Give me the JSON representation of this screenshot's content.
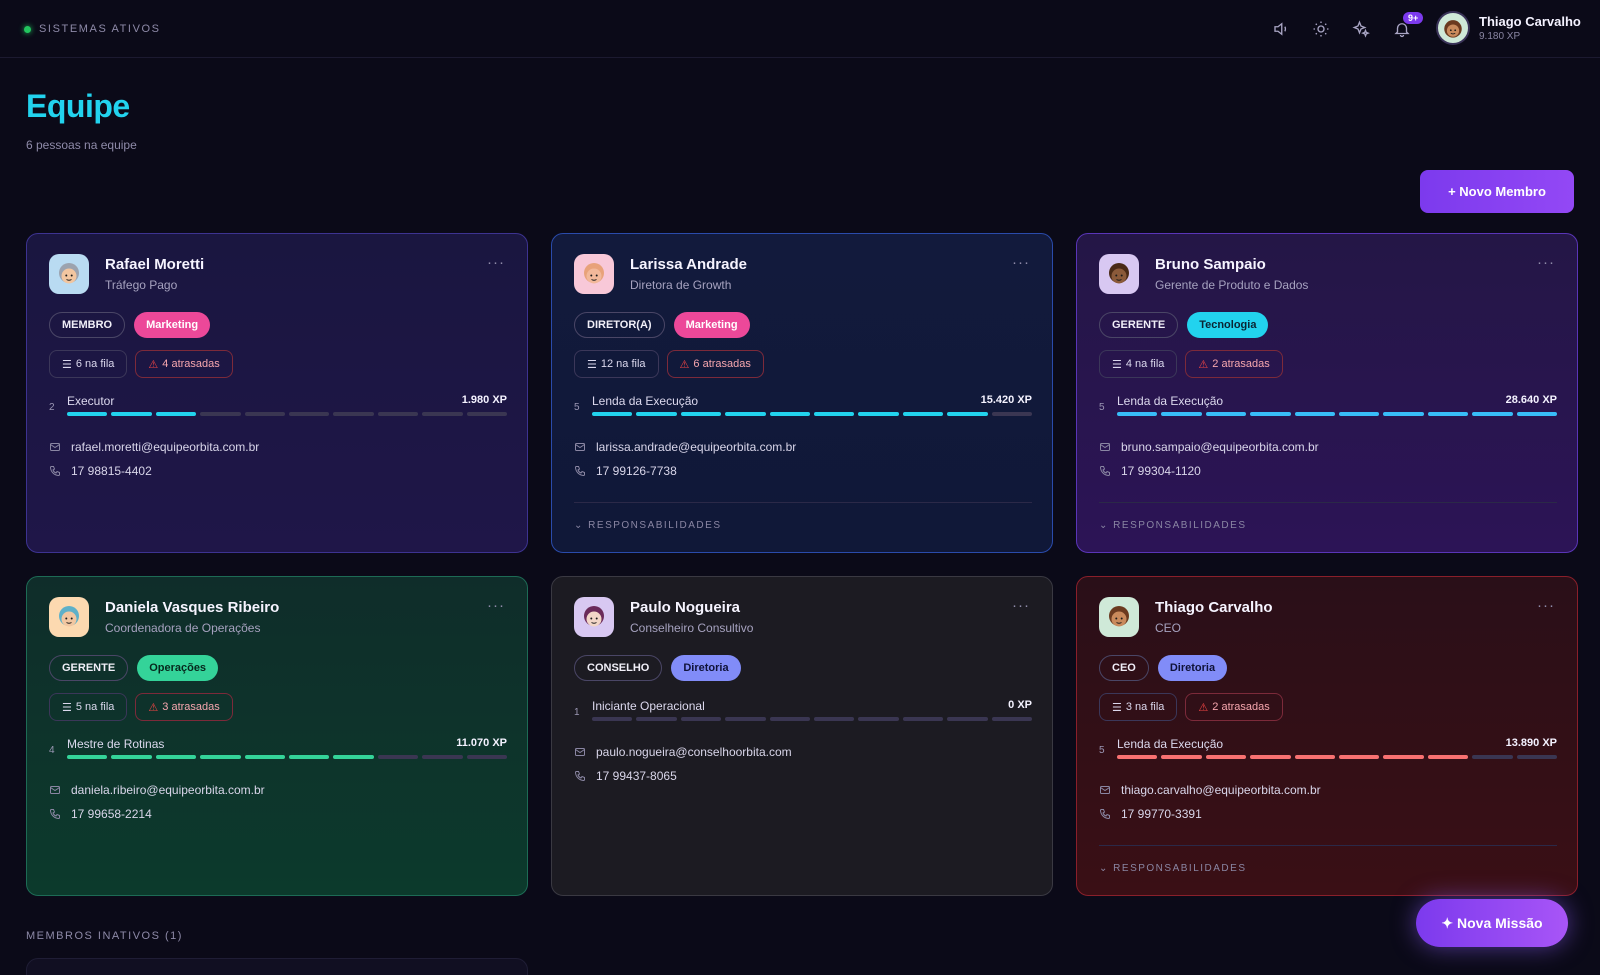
{
  "topbar": {
    "status": "SISTEMAS ATIVOS",
    "notif_count": "9+",
    "user_name": "Thiago Carvalho",
    "user_xp": "9.180 XP"
  },
  "header": {
    "title": "Equipe",
    "subtitle": "6 pessoas na equipe",
    "new_member": "+ Novo Membro"
  },
  "colors": {
    "accent": "#22d3ee",
    "primary": "#7c3aed",
    "marketing": "#ec4899",
    "tecnologia": "#22d3ee",
    "operacoes": "#34d399",
    "diretoria": "#818cf8",
    "warning": "#ef4444"
  },
  "cards": [
    {
      "name": "Rafael Moretti",
      "role": "Tráfego Pago",
      "more": "···",
      "badge_role": "MEMBRO",
      "badge_dept": "Marketing",
      "queue": "6 na fila",
      "late": "4 atrasadas",
      "level": "2",
      "level_name": "Executor",
      "xp": "1.980 XP",
      "progress": 3,
      "email": "rafael.moretti@equipeorbita.com.br",
      "phone": "17 98815-4402"
    },
    {
      "name": "Larissa Andrade",
      "role": "Diretora de Growth",
      "more": "···",
      "badge_role": "DIRETOR(A)",
      "badge_dept": "Marketing",
      "queue": "12 na fila",
      "late": "6 atrasadas",
      "level": "5",
      "level_name": "Lenda da Execução",
      "xp": "15.420 XP",
      "progress": 9,
      "email": "larissa.andrade@equipeorbita.com.br",
      "phone": "17 99126-7738",
      "responsibilities": "RESPONSABILIDADES"
    },
    {
      "name": "Bruno Sampaio",
      "role": "Gerente de Produto e Dados",
      "more": "···",
      "badge_role": "GERENTE",
      "badge_dept": "Tecnologia",
      "queue": "4 na fila",
      "late": "2 atrasadas",
      "level": "5",
      "level_name": "Lenda da Execução",
      "xp": "28.640 XP",
      "progress": 10,
      "email": "bruno.sampaio@equipeorbita.com.br",
      "phone": "17 99304-1120",
      "responsibilities": "RESPONSABILIDADES"
    },
    {
      "name": "Daniela Vasques Ribeiro",
      "role": "Coordenadora de Operações",
      "more": "···",
      "badge_role": "GERENTE",
      "badge_dept": "Operações",
      "queue": "5 na fila",
      "late": "3 atrasadas",
      "level": "4",
      "level_name": "Mestre de Rotinas",
      "xp": "11.070 XP",
      "progress": 7,
      "email": "daniela.ribeiro@equipeorbita.com.br",
      "phone": "17 99658-2214"
    },
    {
      "name": "Paulo Nogueira",
      "role": "Conselheiro Consultivo",
      "more": "···",
      "badge_role": "CONSELHO",
      "badge_dept": "Diretoria",
      "level": "1",
      "level_name": "Iniciante Operacional",
      "xp": "0 XP",
      "progress": 0,
      "email": "paulo.nogueira@conselhoorbita.com",
      "phone": "17 99437-8065"
    },
    {
      "name": "Thiago Carvalho",
      "role": "CEO",
      "more": "···",
      "badge_role": "CEO",
      "badge_dept": "Diretoria",
      "queue": "3 na fila",
      "late": "2 atrasadas",
      "level": "5",
      "level_name": "Lenda da Execução",
      "xp": "13.890 XP",
      "progress": 8,
      "email": "thiago.carvalho@equipeorbita.com.br",
      "phone": "17 99770-3391",
      "responsibilities": "RESPONSABILIDADES"
    }
  ],
  "inactive": {
    "title": "MEMBROS INATIVOS (1)"
  },
  "fab": {
    "label": "✦ Nova Missão"
  }
}
